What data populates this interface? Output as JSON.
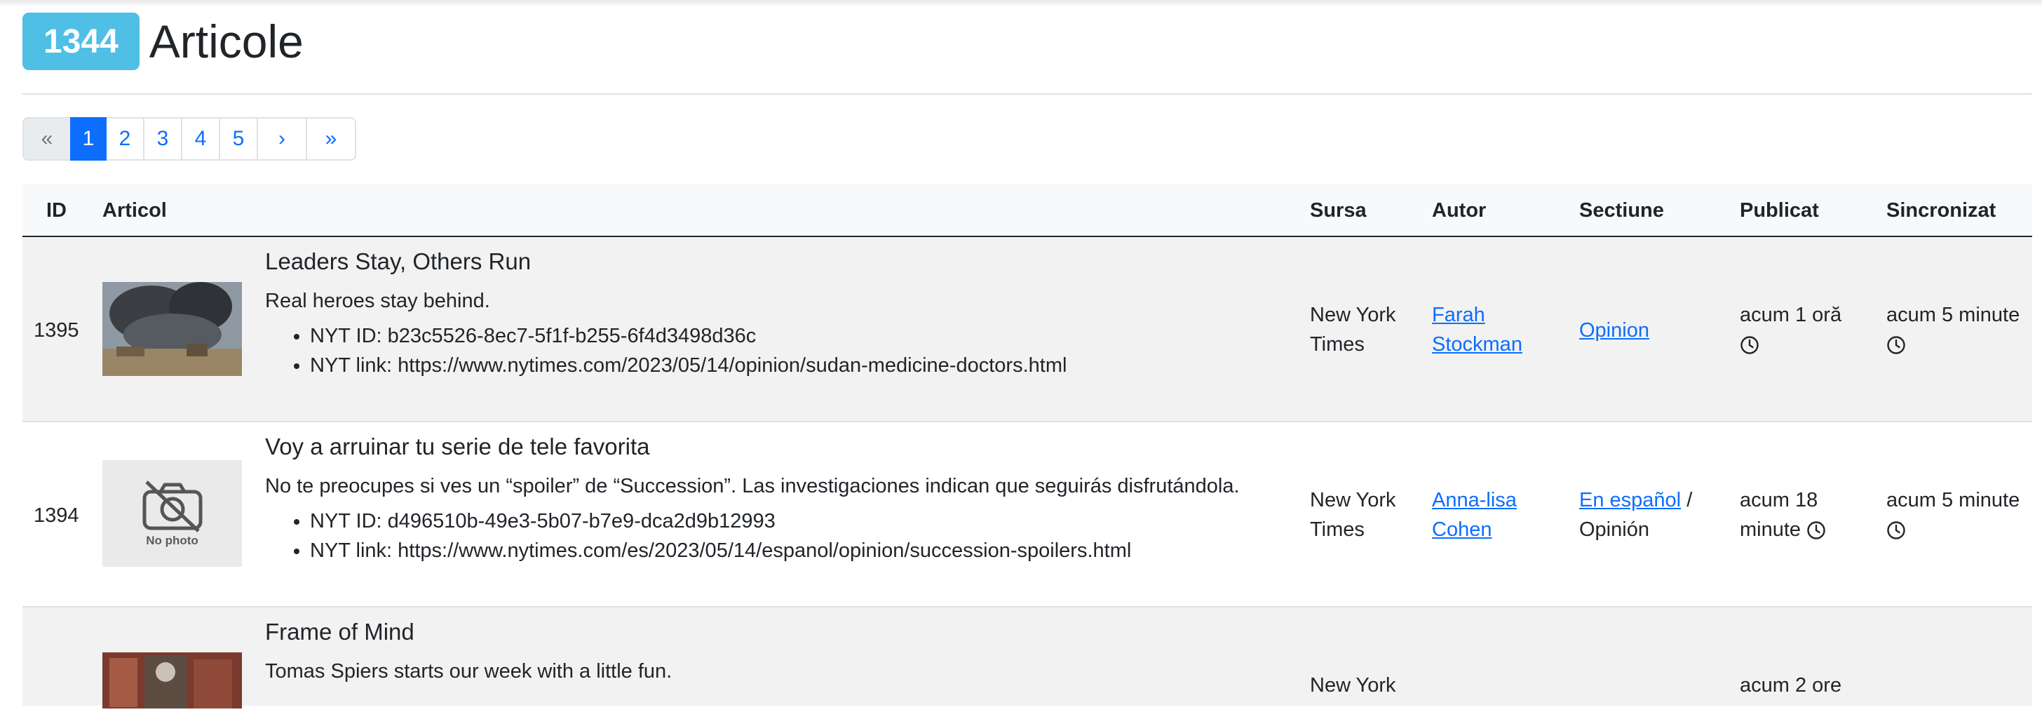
{
  "header": {
    "count": "1344",
    "title": "Articole"
  },
  "pagination": [
    "«",
    "1",
    "2",
    "3",
    "4",
    "5",
    "›",
    "»"
  ],
  "columns": [
    "ID",
    "Articol",
    "Sursa",
    "Autor",
    "Sectiune",
    "Publicat",
    "Sincronizat"
  ],
  "rows": [
    {
      "id": "1395",
      "thumb": "photo",
      "title": "Leaders Stay, Others Run",
      "summary": "Real heroes stay behind.",
      "nyt_id": "NYT ID: b23c5526-8ec7-5f1f-b255-6f4d3498d36c",
      "nyt_link": "NYT link: https://www.nytimes.com/2023/05/14/opinion/sudan-medicine-doctors.html",
      "source": [
        "New York",
        "Times"
      ],
      "author": [
        "Farah",
        "Stockman"
      ],
      "section_link": "Opinion",
      "section_extra": "",
      "published": "acum 1 oră",
      "synced": "acum 5 minute"
    },
    {
      "id": "1394",
      "thumb": "nophoto",
      "thumb_label": "No photo",
      "title": "Voy a arruinar tu serie de tele favorita",
      "summary": "No te preocupes si ves un “spoiler” de “Succession”. Las investigaciones indican que seguirás disfrutándola.",
      "nyt_id": "NYT ID: d496510b-49e3-5b07-b7e9-dca2d9b12993",
      "nyt_link": "NYT link: https://www.nytimes.com/es/2023/05/14/espanol/opinion/succession-spoilers.html",
      "source": [
        "New York",
        "Times"
      ],
      "author": [
        "Anna-lisa",
        "Cohen"
      ],
      "section_link": "En español",
      "section_sep": "/",
      "section_extra": "Opinión",
      "published": "acum 18 minute",
      "published_lines": [
        "acum 18",
        "minute"
      ],
      "synced": "acum 5 minute"
    },
    {
      "title": "Frame of Mind",
      "summary": "Tomas Spiers starts our week with a little fun.",
      "source": [
        "New York"
      ],
      "published": "acum 2 ore"
    }
  ]
}
